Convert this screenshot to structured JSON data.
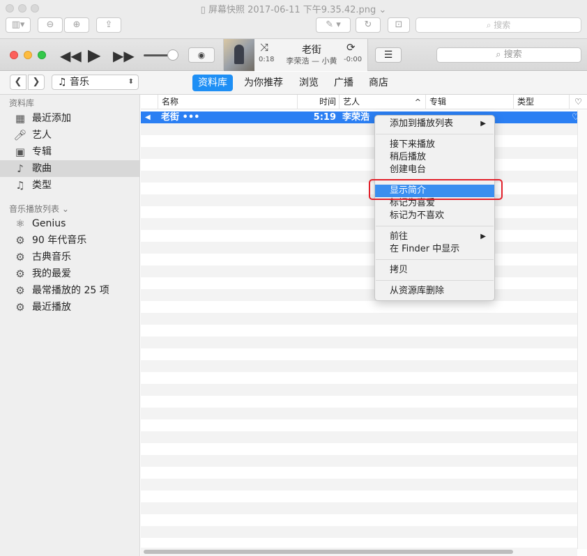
{
  "preview_window": {
    "title": "屏幕快照 2017-06-11 下午9.35.42.png",
    "search_placeholder": "搜索",
    "title_chevron": "⌄"
  },
  "player": {
    "now_playing_title": "老街",
    "now_playing_subtitle": "李荣浩 — 小黄",
    "elapsed": "0:18",
    "remaining": "-0:00",
    "search_placeholder": "搜索"
  },
  "navigation": {
    "media_type": "音乐",
    "tabs": [
      "资料库",
      "为你推荐",
      "浏览",
      "广播",
      "商店"
    ],
    "active_tab": "资料库"
  },
  "sidebar": {
    "library_header": "资料库",
    "library_items": [
      {
        "label": "最近添加",
        "icon": "grid-icon"
      },
      {
        "label": "艺人",
        "icon": "microphone-icon"
      },
      {
        "label": "专辑",
        "icon": "album-icon"
      },
      {
        "label": "歌曲",
        "icon": "music-note-icon",
        "selected": true
      },
      {
        "label": "类型",
        "icon": "genre-icon"
      }
    ],
    "playlists_header": "音乐播放列表",
    "playlists_chevron": "⌄",
    "playlist_items": [
      {
        "label": "Genius",
        "icon": "genius-icon"
      },
      {
        "label": "90 年代音乐",
        "icon": "gear-icon"
      },
      {
        "label": "古典音乐",
        "icon": "gear-icon"
      },
      {
        "label": "我的最爱",
        "icon": "gear-icon"
      },
      {
        "label": "最常播放的 25 项",
        "icon": "gear-icon"
      },
      {
        "label": "最近播放",
        "icon": "gear-icon"
      }
    ]
  },
  "song_table": {
    "columns": [
      "名称",
      "时间",
      "艺人",
      "专辑",
      "类型"
    ],
    "sort_indicator": "^",
    "love_column_icon": "heart-icon",
    "rows": [
      {
        "name": "老街 •••",
        "time": "5:19",
        "artist": "李荣浩",
        "selected": true,
        "playing": true
      }
    ]
  },
  "context_menu": {
    "items": [
      {
        "label": "添加到播放列表",
        "submenu": true
      },
      {
        "label": "接下来播放"
      },
      {
        "label": "稍后播放"
      },
      {
        "label": "创建电台"
      },
      {
        "label": "显示简介",
        "highlighted": true
      },
      {
        "label": "标记为喜爱"
      },
      {
        "label": "标记为不喜欢"
      },
      {
        "label": "前往",
        "submenu": true
      },
      {
        "label": "在 Finder 中显示"
      },
      {
        "label": "拷贝"
      },
      {
        "label": "从资源库删除"
      }
    ],
    "highlight_color": "#3b8ff0",
    "annotation_color": "#e2202a"
  },
  "accent_color": "#1e8ff5"
}
